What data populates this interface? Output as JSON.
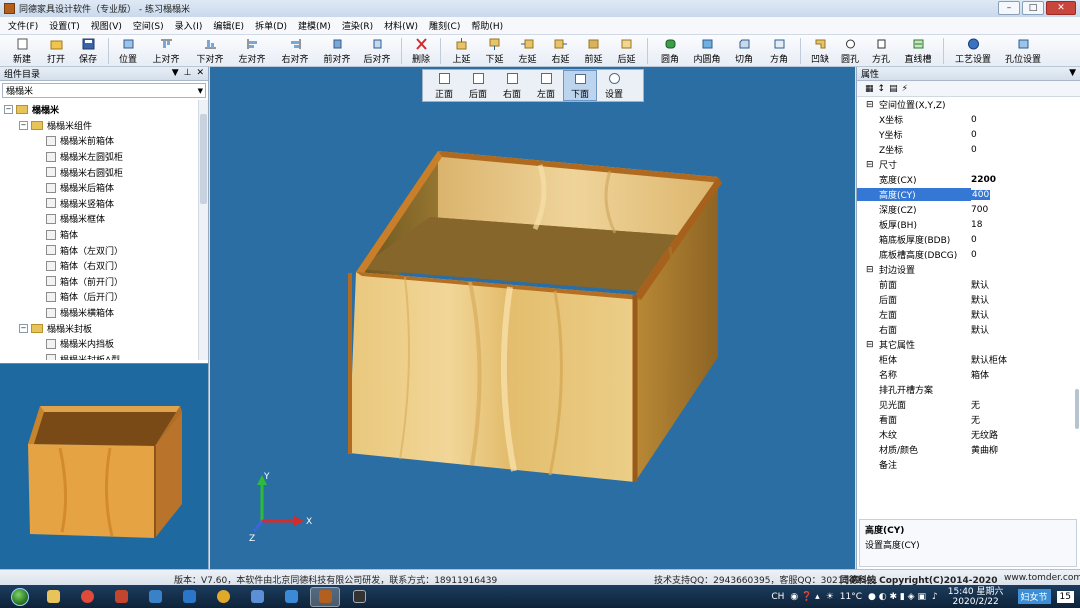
{
  "window": {
    "title": "同德家具设计软件（专业版） - 练习榻榻米"
  },
  "menu": [
    "文件(F)",
    "设置(T)",
    "视图(V)",
    "空间(S)",
    "录入(I)",
    "编辑(E)",
    "拆单(D)",
    "建模(M)",
    "渲染(R)",
    "材料(W)",
    "雕刻(C)",
    "帮助(H)"
  ],
  "toolbar": {
    "group1": [
      "新建",
      "打开",
      "保存"
    ],
    "group2": [
      "位置",
      "上对齐",
      "下对齐",
      "左对齐",
      "右对齐",
      "前对齐",
      "后对齐"
    ],
    "group3": [
      "删除"
    ],
    "group4": [
      "上延",
      "下延",
      "左延",
      "右延",
      "前延",
      "后延"
    ],
    "group5": [
      "圆角",
      "内圆角",
      "切角",
      "方角"
    ],
    "group6": [
      "凹缺",
      "圆孔",
      "方孔",
      "直线槽"
    ],
    "group7": [
      "工艺设置",
      "孔位设置"
    ]
  },
  "viewtools": [
    "正面",
    "后面",
    "右面",
    "左面",
    "下面",
    "设置"
  ],
  "left_panel": {
    "title": "组件目录",
    "combo": "榻榻米",
    "tree": [
      {
        "label": "榻榻米",
        "level": 0,
        "type": "folder",
        "bold": true
      },
      {
        "label": "榻榻米组件",
        "level": 1,
        "type": "folder"
      },
      {
        "label": "榻榻米前箱体",
        "level": 2,
        "type": "doc"
      },
      {
        "label": "榻榻米左圆弧柜",
        "level": 2,
        "type": "doc"
      },
      {
        "label": "榻榻米右圆弧柜",
        "level": 2,
        "type": "doc"
      },
      {
        "label": "榻榻米后箱体",
        "level": 2,
        "type": "doc"
      },
      {
        "label": "榻榻米竖箱体",
        "level": 2,
        "type": "doc"
      },
      {
        "label": "榻榻米框体",
        "level": 2,
        "type": "doc"
      },
      {
        "label": "箱体",
        "level": 2,
        "type": "doc"
      },
      {
        "label": "箱体（左双门）",
        "level": 2,
        "type": "doc"
      },
      {
        "label": "箱体（右双门）",
        "level": 2,
        "type": "doc"
      },
      {
        "label": "箱体（前开门）",
        "level": 2,
        "type": "doc"
      },
      {
        "label": "箱体（后开门）",
        "level": 2,
        "type": "doc"
      },
      {
        "label": "榻榻米横箱体",
        "level": 2,
        "type": "doc"
      },
      {
        "label": "榻榻米封板",
        "level": 1,
        "type": "folder"
      },
      {
        "label": "榻榻米内挡板",
        "level": 2,
        "type": "doc"
      },
      {
        "label": "榻榻米封板A型",
        "level": 2,
        "type": "doc"
      }
    ]
  },
  "right_panel": {
    "title": "属性",
    "groups": [
      {
        "name": "空间位置(X,Y,Z)",
        "rows": [
          [
            "X坐标",
            "0"
          ],
          [
            "Y坐标",
            "0"
          ],
          [
            "Z坐标",
            "0"
          ]
        ]
      },
      {
        "name": "尺寸",
        "rows": [
          [
            "宽度(CX)",
            "2200"
          ],
          [
            "高度(CY)",
            "400"
          ],
          [
            "深度(CZ)",
            "700"
          ],
          [
            "板厚(BH)",
            "18"
          ],
          [
            "箱底板厚度(BDB)",
            "0"
          ],
          [
            "底板槽高度(DBCG)",
            "0"
          ]
        ]
      },
      {
        "name": "封边设置",
        "rows": [
          [
            "前面",
            "默认"
          ],
          [
            "后面",
            "默认"
          ],
          [
            "左面",
            "默认"
          ],
          [
            "右面",
            "默认"
          ]
        ]
      },
      {
        "name": "其它属性",
        "rows": [
          [
            "柜体",
            "默认柜体"
          ],
          [
            "名称",
            "箱体"
          ],
          [
            "排孔开槽方案",
            ""
          ],
          [
            "见光面",
            "无"
          ],
          [
            "看面",
            "无"
          ],
          [
            "木纹",
            "无纹路"
          ],
          [
            "材质/颜色",
            "黄曲柳"
          ],
          [
            "备注",
            ""
          ]
        ]
      }
    ],
    "help_title": "高度(CY)",
    "help_text": "设置高度(CY)"
  },
  "viewport": {
    "axis_x": "X",
    "axis_y": "Y",
    "axis_z": "Z"
  },
  "status": {
    "version": "版本：V7.60，本软件由北京同德科技有限公司研发，联系方式：18911916439",
    "support": "技术支持QQ：2943660395，客服QQ：3021342591",
    "copyright": "同德科技 Copyright(C)2014-2020",
    "site": "www.tomder.com"
  },
  "taskbar": {
    "lang": "CH",
    "weather": "11°C",
    "time": "15:40 星期六",
    "date": "2020/2/22",
    "badge": "妇女节",
    "badge_num": "15"
  },
  "colors": {
    "viewport_bg": "#2b6ea3",
    "wood_light": "#e8c67a",
    "wood_dark": "#b46f1e",
    "selection": "#3477d4"
  }
}
